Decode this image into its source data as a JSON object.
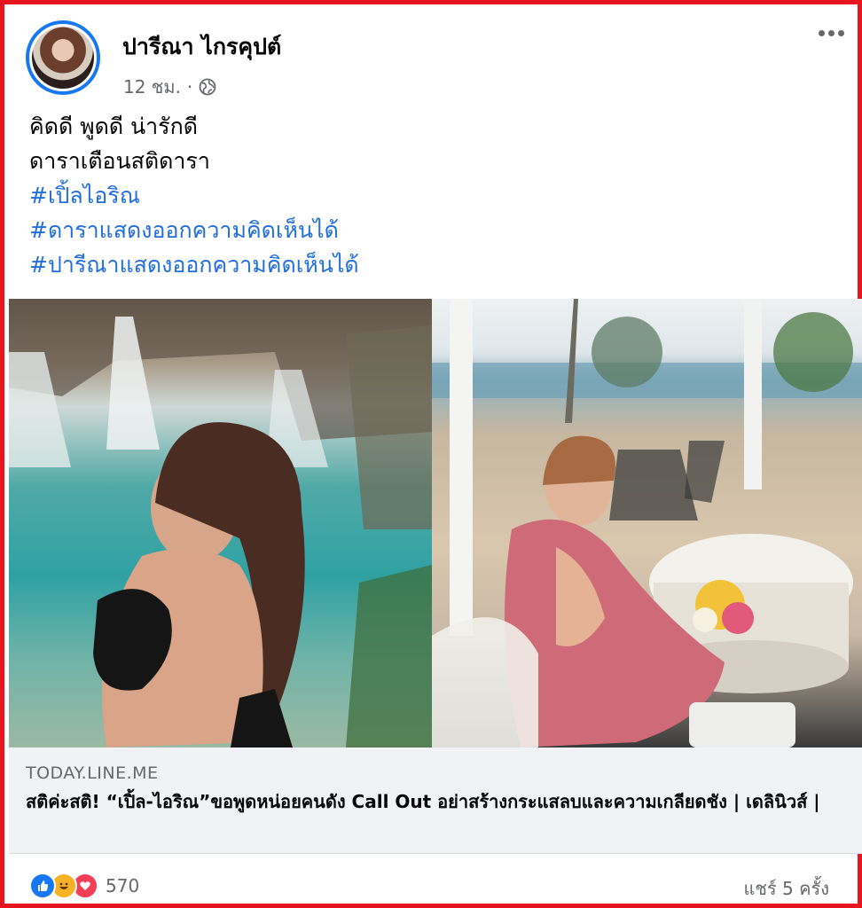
{
  "post": {
    "author": "ปารีณา ไกรคุปต์",
    "time": "12 ชม.",
    "separator": "·",
    "privacy_icon": "globe-icon",
    "menu_icon": "more-options-icon"
  },
  "text": {
    "line1": "คิดดี พูดดี น่ารักดี",
    "line2": "ดาราเตือนสติดารา",
    "hashtags": [
      "#เปิ้ลไอริณ",
      "#ดาราแสดงออกความคิดเห็นได้",
      "#ปารีณาแสดงออกความคิดเห็นได้"
    ]
  },
  "link_preview": {
    "domain": "TODAY.LINE.ME",
    "title": "สติค่ะสติ! “เปิ้ล-ไอริณ”ขอพูดหน่อยคนดัง Call Out อย่าสร้างกระแสลบและความเกลียดชัง | เดลินิวส์ |"
  },
  "footer": {
    "reaction_icons": [
      "like-icon",
      "haha-icon",
      "love-icon"
    ],
    "reaction_count": "570",
    "shares": "แชร์ 5 ครั้ง"
  },
  "colors": {
    "frame_border": "#e8141e",
    "link_blue": "#216fdb",
    "accent": "#1877f2",
    "secondary_text": "#65676b",
    "preview_bg": "#f0f2f5"
  }
}
